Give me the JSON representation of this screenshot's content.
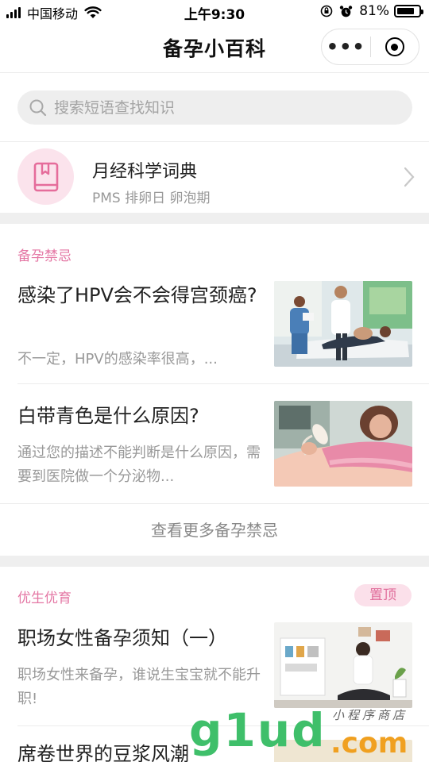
{
  "status_bar": {
    "carrier": "中国移动",
    "time": "上午9:30",
    "battery_percent": "81%",
    "battery_level": 0.81
  },
  "nav": {
    "title": "备孕小百科",
    "more_glyph": "•••"
  },
  "search": {
    "placeholder": "搜索短语查找知识"
  },
  "dictionary": {
    "title": "月经科学词典",
    "tags": "PMS 排卵日 卵泡期"
  },
  "section_taboo": {
    "title": "备孕禁忌",
    "articles": [
      {
        "title": "感染了HPV会不会得宫颈癌?",
        "desc": "不一定，HPV的感染率很高，..."
      },
      {
        "title": "白带青色是什么原因?",
        "desc": "通过您的描述不能判断是什么原因，需要到医院做一个分泌物..."
      }
    ],
    "more_label": "查看更多备孕禁忌"
  },
  "section_eugenics": {
    "title": "优生优育",
    "pin_label": "置顶",
    "articles": [
      {
        "title": "职场女性备孕须知（一）",
        "desc": "职场女性来备孕，谁说生宝宝就不能升职!"
      },
      {
        "title": "席卷世界的豆浆风潮",
        "desc": ""
      }
    ]
  },
  "watermark": {
    "main": "g1ud",
    "suffix": ".com",
    "sub": "小程序商店"
  },
  "colors": {
    "accent_pink": "#e477a4",
    "pin_bg": "#fbe0ea",
    "band_gray": "#efefef"
  }
}
